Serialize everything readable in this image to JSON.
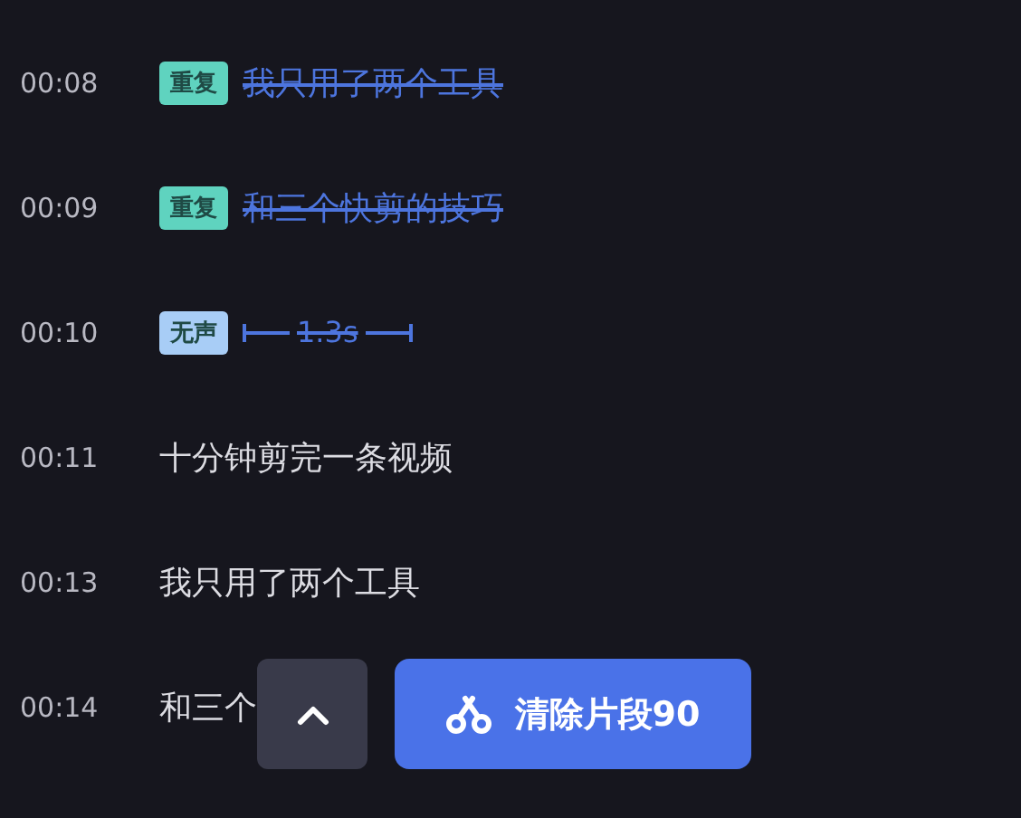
{
  "rows": [
    {
      "time": "00:08",
      "tag": {
        "label": "重复",
        "color": "#5fd3bf"
      },
      "text": "我只用了两个工具",
      "deleted": true,
      "kind": "text"
    },
    {
      "time": "00:09",
      "tag": {
        "label": "重复",
        "color": "#5fd3bf"
      },
      "text": "和三个快剪的技巧",
      "deleted": true,
      "kind": "text"
    },
    {
      "time": "00:10",
      "tag": {
        "label": "无声",
        "color": "#a8cdf6"
      },
      "text": "1.3s",
      "deleted": true,
      "kind": "pause"
    },
    {
      "time": "00:11",
      "text": "十分钟剪完一条视频",
      "deleted": false,
      "kind": "text"
    },
    {
      "time": "00:13",
      "text": "我只用了两个工具",
      "deleted": false,
      "kind": "text"
    },
    {
      "time": "00:14",
      "text": "和三个",
      "deleted": false,
      "kind": "text"
    }
  ],
  "buttons": {
    "clear": "清除片段90"
  }
}
